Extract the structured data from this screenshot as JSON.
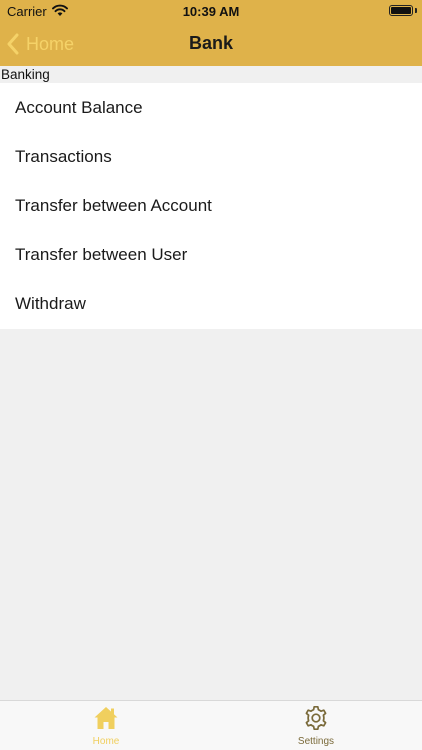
{
  "status_bar": {
    "carrier": "Carrier",
    "time": "10:39 AM"
  },
  "nav": {
    "back_label": "Home",
    "title": "Bank"
  },
  "section": {
    "header": "Banking"
  },
  "menu": {
    "items": [
      {
        "label": "Account Balance"
      },
      {
        "label": "Transactions"
      },
      {
        "label": "Transfer between Account"
      },
      {
        "label": "Transfer between User"
      },
      {
        "label": "Withdraw"
      }
    ]
  },
  "tab_bar": {
    "tabs": [
      {
        "label": "Home",
        "icon": "home-icon",
        "selected": true
      },
      {
        "label": "Settings",
        "icon": "gear-icon",
        "selected": false
      }
    ]
  },
  "colors": {
    "header_background": "#dfb24a",
    "accent": "#f0cf5e",
    "list_background": "#ffffff",
    "page_background": "#f0f0f0"
  }
}
